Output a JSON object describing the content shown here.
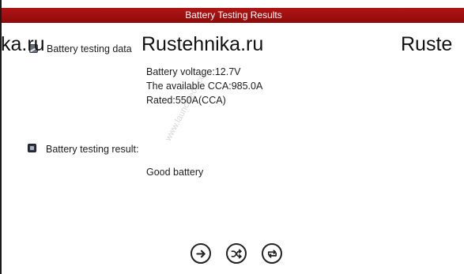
{
  "window": {
    "title": "Battery Testing Results"
  },
  "watermarks": {
    "left": "ka.ru",
    "center": "Rustehnika.ru",
    "right": "Ruste",
    "diagonal": "www.launchtech.co"
  },
  "sections": {
    "data": {
      "label": "Battery testing data",
      "icon": "battery-chart-icon",
      "lines": [
        "Battery voltage:12.7V",
        "The available CCA:985.0A",
        "Rated:550A(CCA)"
      ]
    },
    "result": {
      "label": "Battery testing result:",
      "icon": "battery-result-icon",
      "lines": [
        "Good battery"
      ]
    }
  },
  "toolbar": {
    "buttons": [
      {
        "name": "next",
        "icon": "arrow-right-icon"
      },
      {
        "name": "shuffle",
        "icon": "shuffle-icon"
      },
      {
        "name": "repeat",
        "icon": "repeat-icon"
      }
    ]
  },
  "colors": {
    "title_bar": "#a01010",
    "title_text": "#ffffff",
    "text": "#1e1e1e"
  }
}
